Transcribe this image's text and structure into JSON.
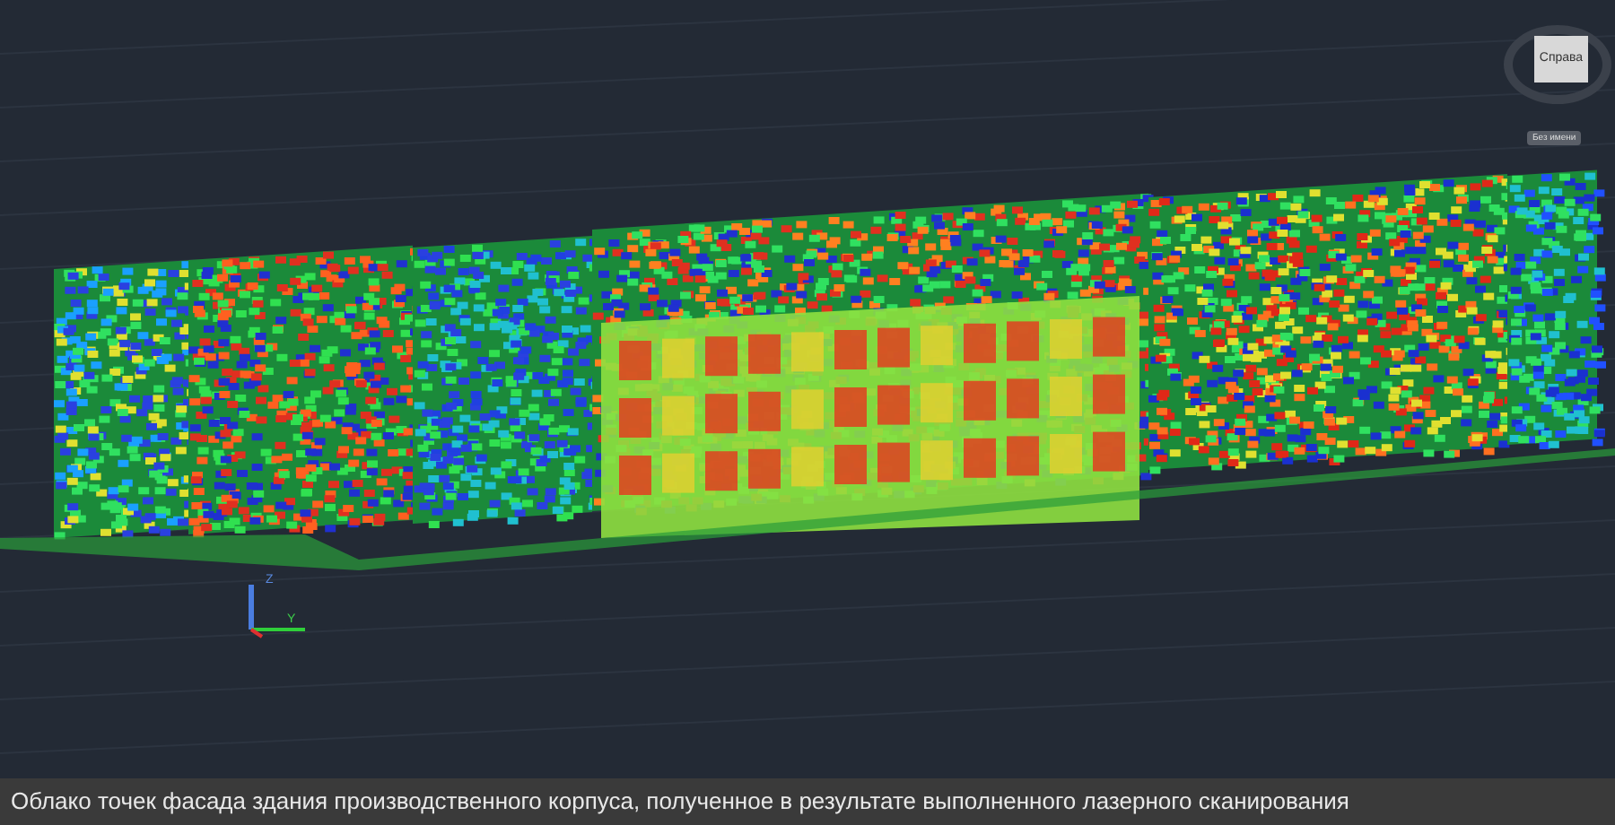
{
  "viewcube": {
    "face_label": "Справа"
  },
  "ucs_button": {
    "label": "Без имени"
  },
  "ucs_icon": {
    "z_label": "Z",
    "y_label": "Y"
  },
  "caption": "Облако точек фасада здания производственного корпуса, полученное в результате выполненного лазерного сканирования"
}
